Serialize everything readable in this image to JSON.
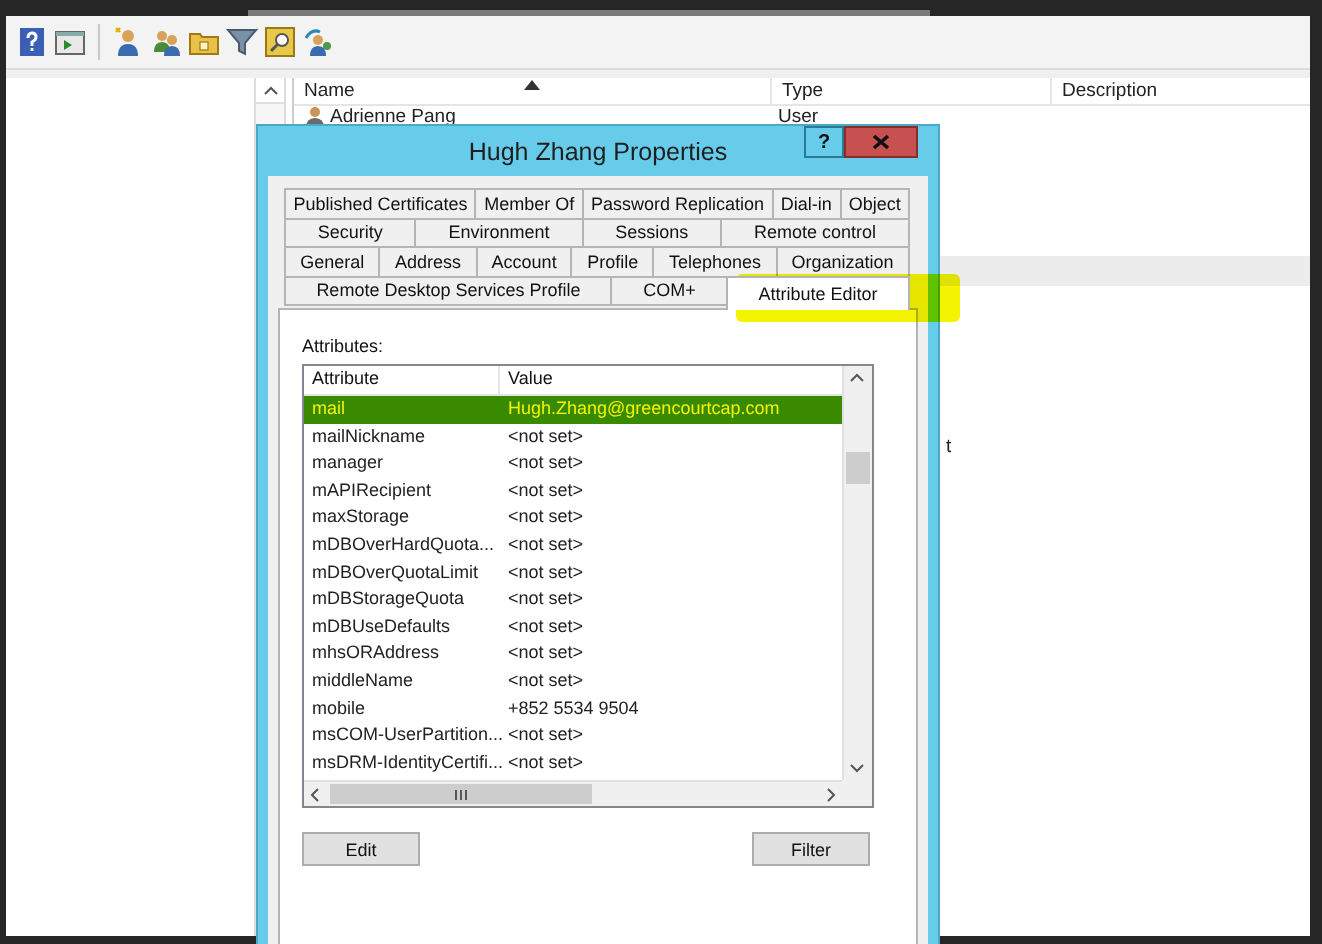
{
  "list": {
    "columns": [
      {
        "label": "Name",
        "sorted": true
      },
      {
        "label": "Type",
        "sorted": false
      },
      {
        "label": "Description",
        "sorted": false
      }
    ],
    "rows": [
      {
        "name": "Adrienne Pang",
        "type": "User",
        "selected": false
      },
      {
        "selected": false
      },
      {
        "selected": false
      },
      {
        "selected": false
      },
      {
        "selected": false
      },
      {
        "selected": true
      },
      {
        "selected": false
      },
      {
        "selected": false
      },
      {
        "selected": false
      },
      {
        "selected": false
      },
      {
        "selected": false
      },
      {
        "type": "t",
        "clipped": true,
        "selected": false
      }
    ]
  },
  "dialog": {
    "title": "Hugh Zhang Properties",
    "help": "?",
    "tab_rows": [
      [
        {
          "label": "Published Certificates",
          "selected": false
        },
        {
          "label": "Member Of",
          "selected": false
        },
        {
          "label": "Password Replication",
          "selected": false
        },
        {
          "label": "Dial-in",
          "selected": false
        },
        {
          "label": "Object",
          "selected": false
        }
      ],
      [
        {
          "label": "Security",
          "selected": false
        },
        {
          "label": "Environment",
          "selected": false
        },
        {
          "label": "Sessions",
          "selected": false
        },
        {
          "label": "Remote control",
          "selected": false
        }
      ],
      [
        {
          "label": "General",
          "selected": false
        },
        {
          "label": "Address",
          "selected": false
        },
        {
          "label": "Account",
          "selected": false
        },
        {
          "label": "Profile",
          "selected": false
        },
        {
          "label": "Telephones",
          "selected": false
        },
        {
          "label": "Organization",
          "selected": false
        }
      ],
      [
        {
          "label": "Remote Desktop Services Profile",
          "selected": false
        },
        {
          "label": "COM+",
          "selected": false
        },
        {
          "label": "Attribute Editor",
          "selected": true
        }
      ]
    ],
    "attributes_label": {
      "text": "Attributes:"
    },
    "attributes": {
      "columns": [
        "Attribute",
        "Value"
      ],
      "rows": [
        {
          "attribute": "mail",
          "value": "Hugh.Zhang@greencourtcap.com",
          "selected": true
        },
        {
          "attribute": "mailNickname",
          "value": "<not set>",
          "selected": false
        },
        {
          "attribute": "manager",
          "value": "<not set>",
          "selected": false
        },
        {
          "attribute": "mAPIRecipient",
          "value": "<not set>",
          "selected": false
        },
        {
          "attribute": "maxStorage",
          "value": "<not set>",
          "selected": false
        },
        {
          "attribute": "mDBOverHardQuota...",
          "value": "<not set>",
          "selected": false
        },
        {
          "attribute": "mDBOverQuotaLimit",
          "value": "<not set>",
          "selected": false
        },
        {
          "attribute": "mDBStorageQuota",
          "value": "<not set>",
          "selected": false
        },
        {
          "attribute": "mDBUseDefaults",
          "value": "<not set>",
          "selected": false
        },
        {
          "attribute": "mhsORAddress",
          "value": "<not set>",
          "selected": false
        },
        {
          "attribute": "middleName",
          "value": "<not set>",
          "selected": false
        },
        {
          "attribute": "mobile",
          "value": "+852 5534 9504",
          "selected": false
        },
        {
          "attribute": "msCOM-UserPartition...",
          "value": "<not set>",
          "selected": false
        },
        {
          "attribute": "msDRM-IdentityCertifi...",
          "value": "<not set>",
          "selected": false
        }
      ]
    },
    "buttons": [
      {
        "label": "Edit"
      },
      {
        "label": "Filter"
      }
    ]
  }
}
